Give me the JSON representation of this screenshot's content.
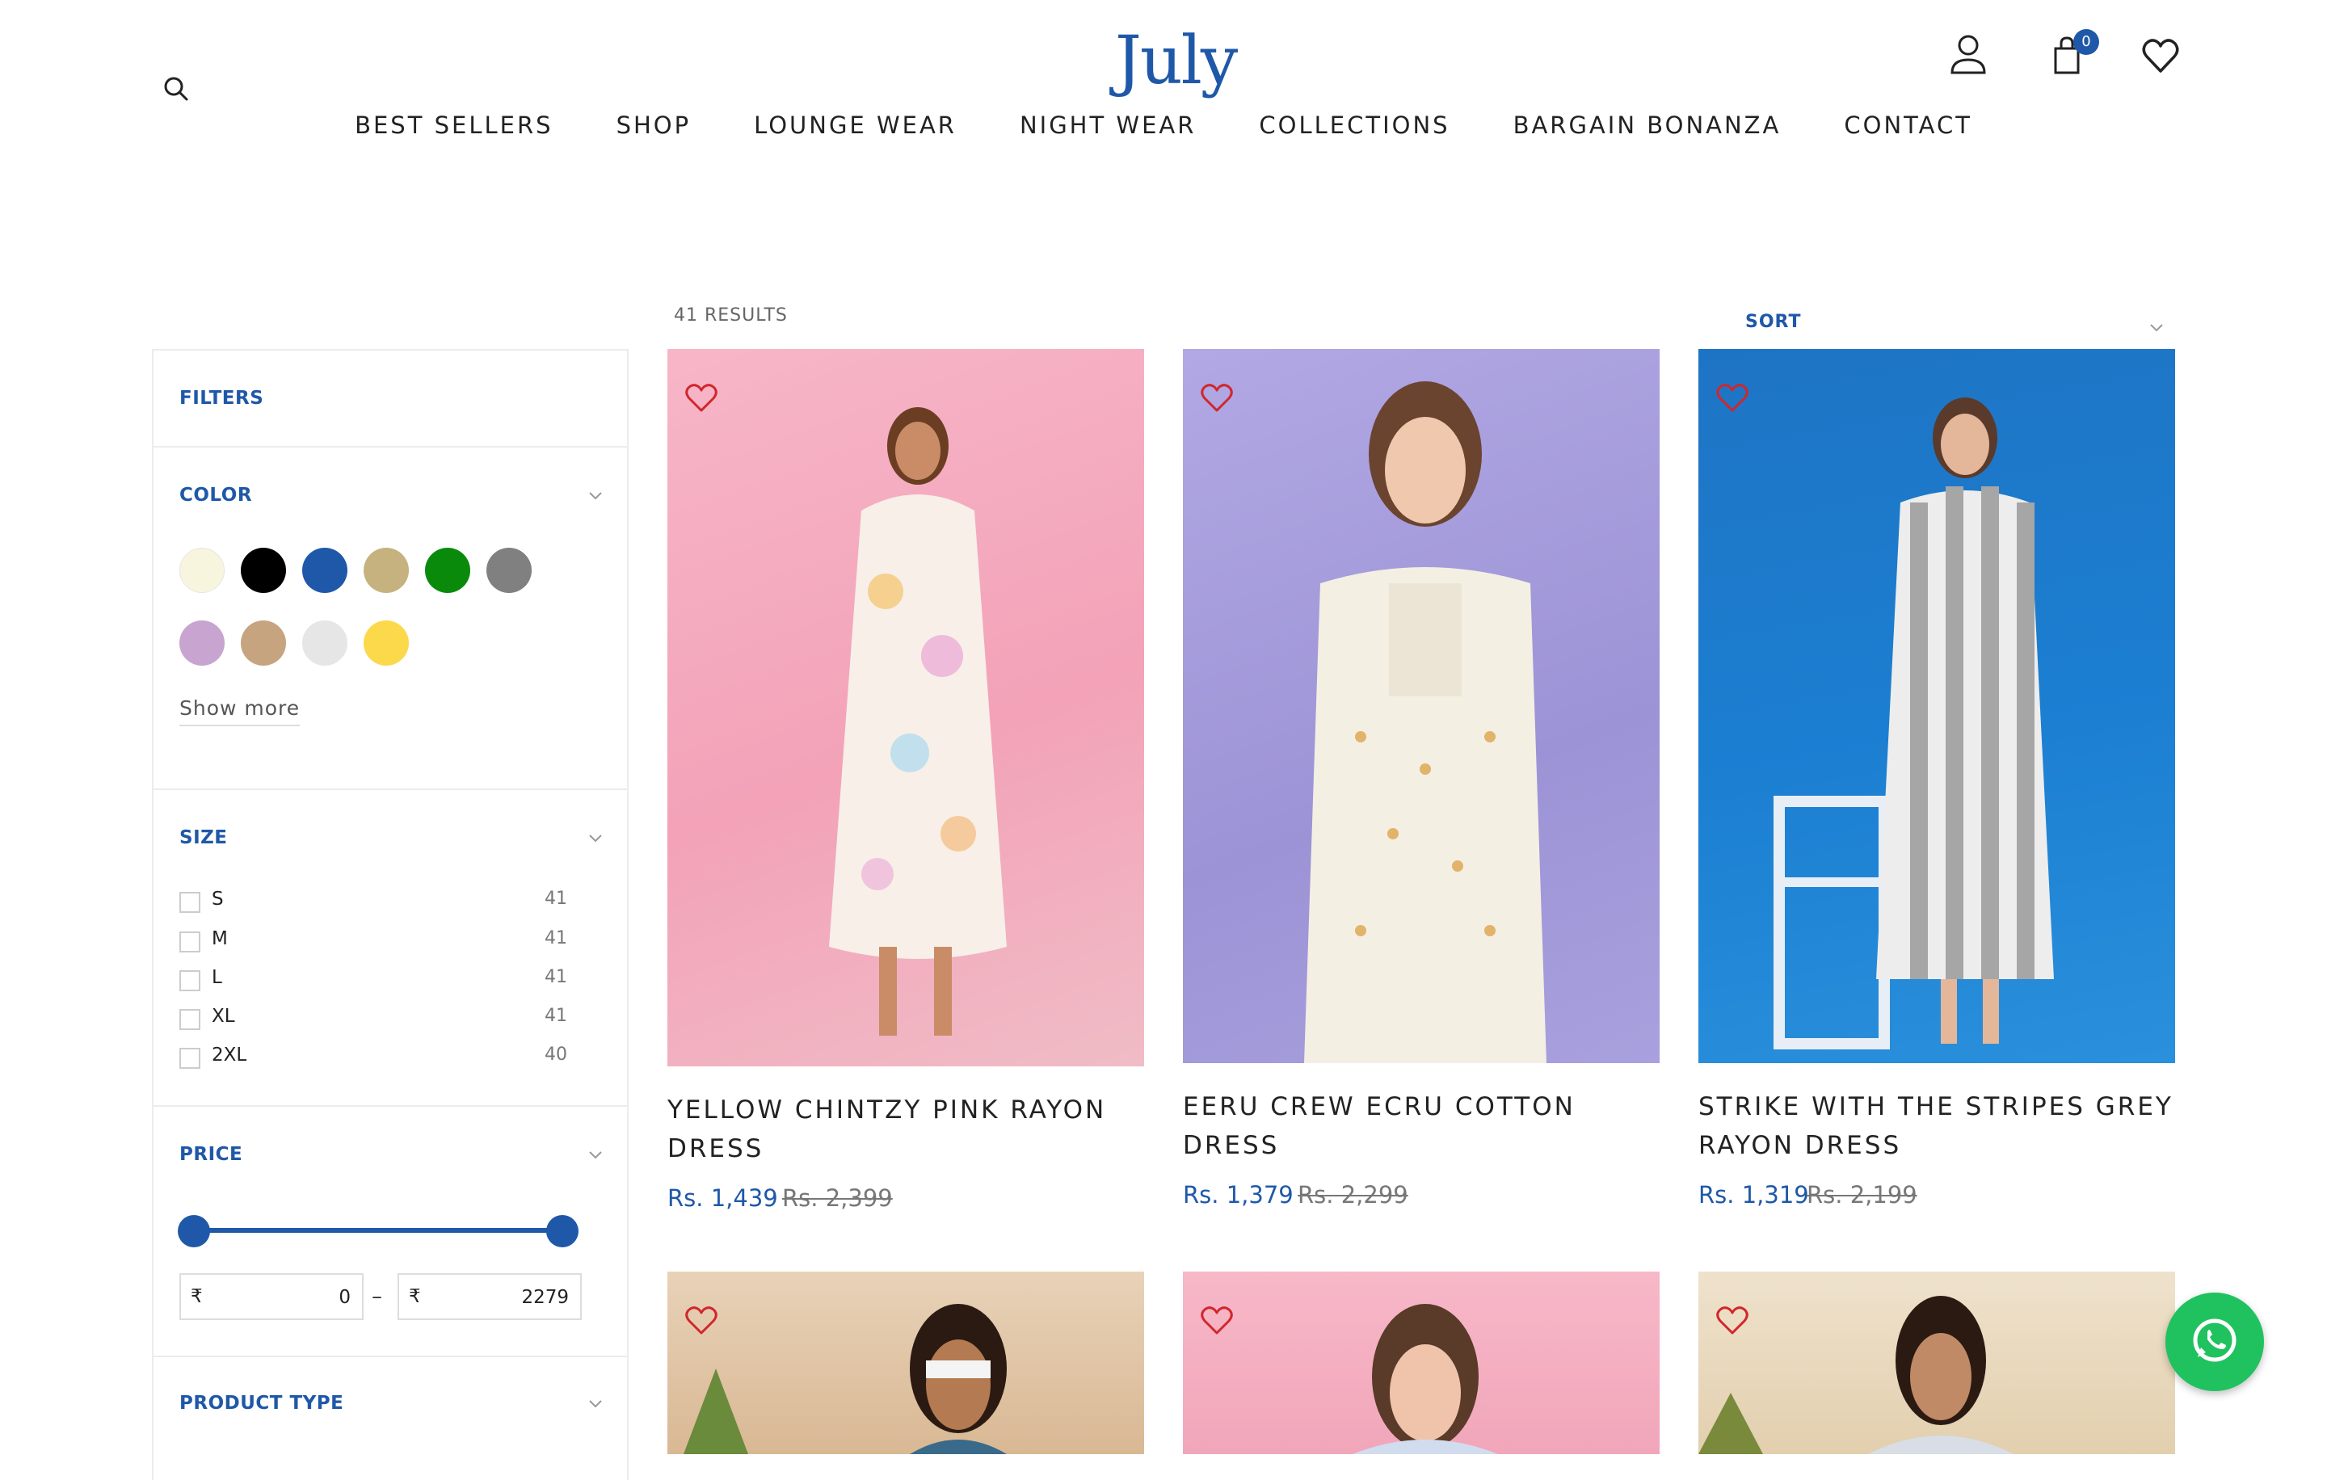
{
  "brand": {
    "logo_text": "July"
  },
  "header": {
    "cart_count": "0",
    "icons": [
      "search-icon",
      "user-icon",
      "cart-icon",
      "wishlist-heart-icon"
    ]
  },
  "nav": {
    "items": [
      "BEST SELLERS",
      "SHOP",
      "LOUNGE WEAR",
      "NIGHT WEAR",
      "COLLECTIONS",
      "BARGAIN BONANZA",
      "CONTACT"
    ]
  },
  "results": {
    "label": "41 RESULTS"
  },
  "sort": {
    "label": "SORT"
  },
  "filters": {
    "title": "FILTERS",
    "color": {
      "label": "COLOR",
      "swatches": [
        "#f7f5dd",
        "#000000",
        "#1f58a8",
        "#c6b27e",
        "#0a8a0a",
        "#808080",
        "#c8a4d0",
        "#c6a480",
        "#e6e6e6",
        "#fcd94a"
      ],
      "show_more": "Show more"
    },
    "size": {
      "label": "SIZE",
      "options": [
        {
          "name": "S",
          "count": "41"
        },
        {
          "name": "M",
          "count": "41"
        },
        {
          "name": "L",
          "count": "41"
        },
        {
          "name": "XL",
          "count": "41"
        },
        {
          "name": "2XL",
          "count": "40"
        }
      ]
    },
    "price": {
      "label": "PRICE",
      "currency": "₹",
      "min": "0",
      "max": "2279",
      "separator": "–"
    },
    "product_type": {
      "label": "PRODUCT TYPE"
    }
  },
  "products": [
    {
      "title_line1": "YELLOW CHINTZY PINK RAYON",
      "title_line2": "DRESS",
      "price": "Rs. 1,439",
      "old_price": "Rs. 2,399"
    },
    {
      "title_line1": "EERU CREW ECRU COTTON",
      "title_line2": "DRESS",
      "price": "Rs. 1,379",
      "old_price": "Rs. 2,299"
    },
    {
      "title_line1": "STRIKE WITH THE STRIPES GREY",
      "title_line2": "RAYON DRESS",
      "price": "Rs. 1,319",
      "old_price": "Rs. 2,199"
    }
  ],
  "colors": {
    "accent": "#1f58a8",
    "heart": "#d0272c",
    "whatsapp": "#1fc25f"
  }
}
